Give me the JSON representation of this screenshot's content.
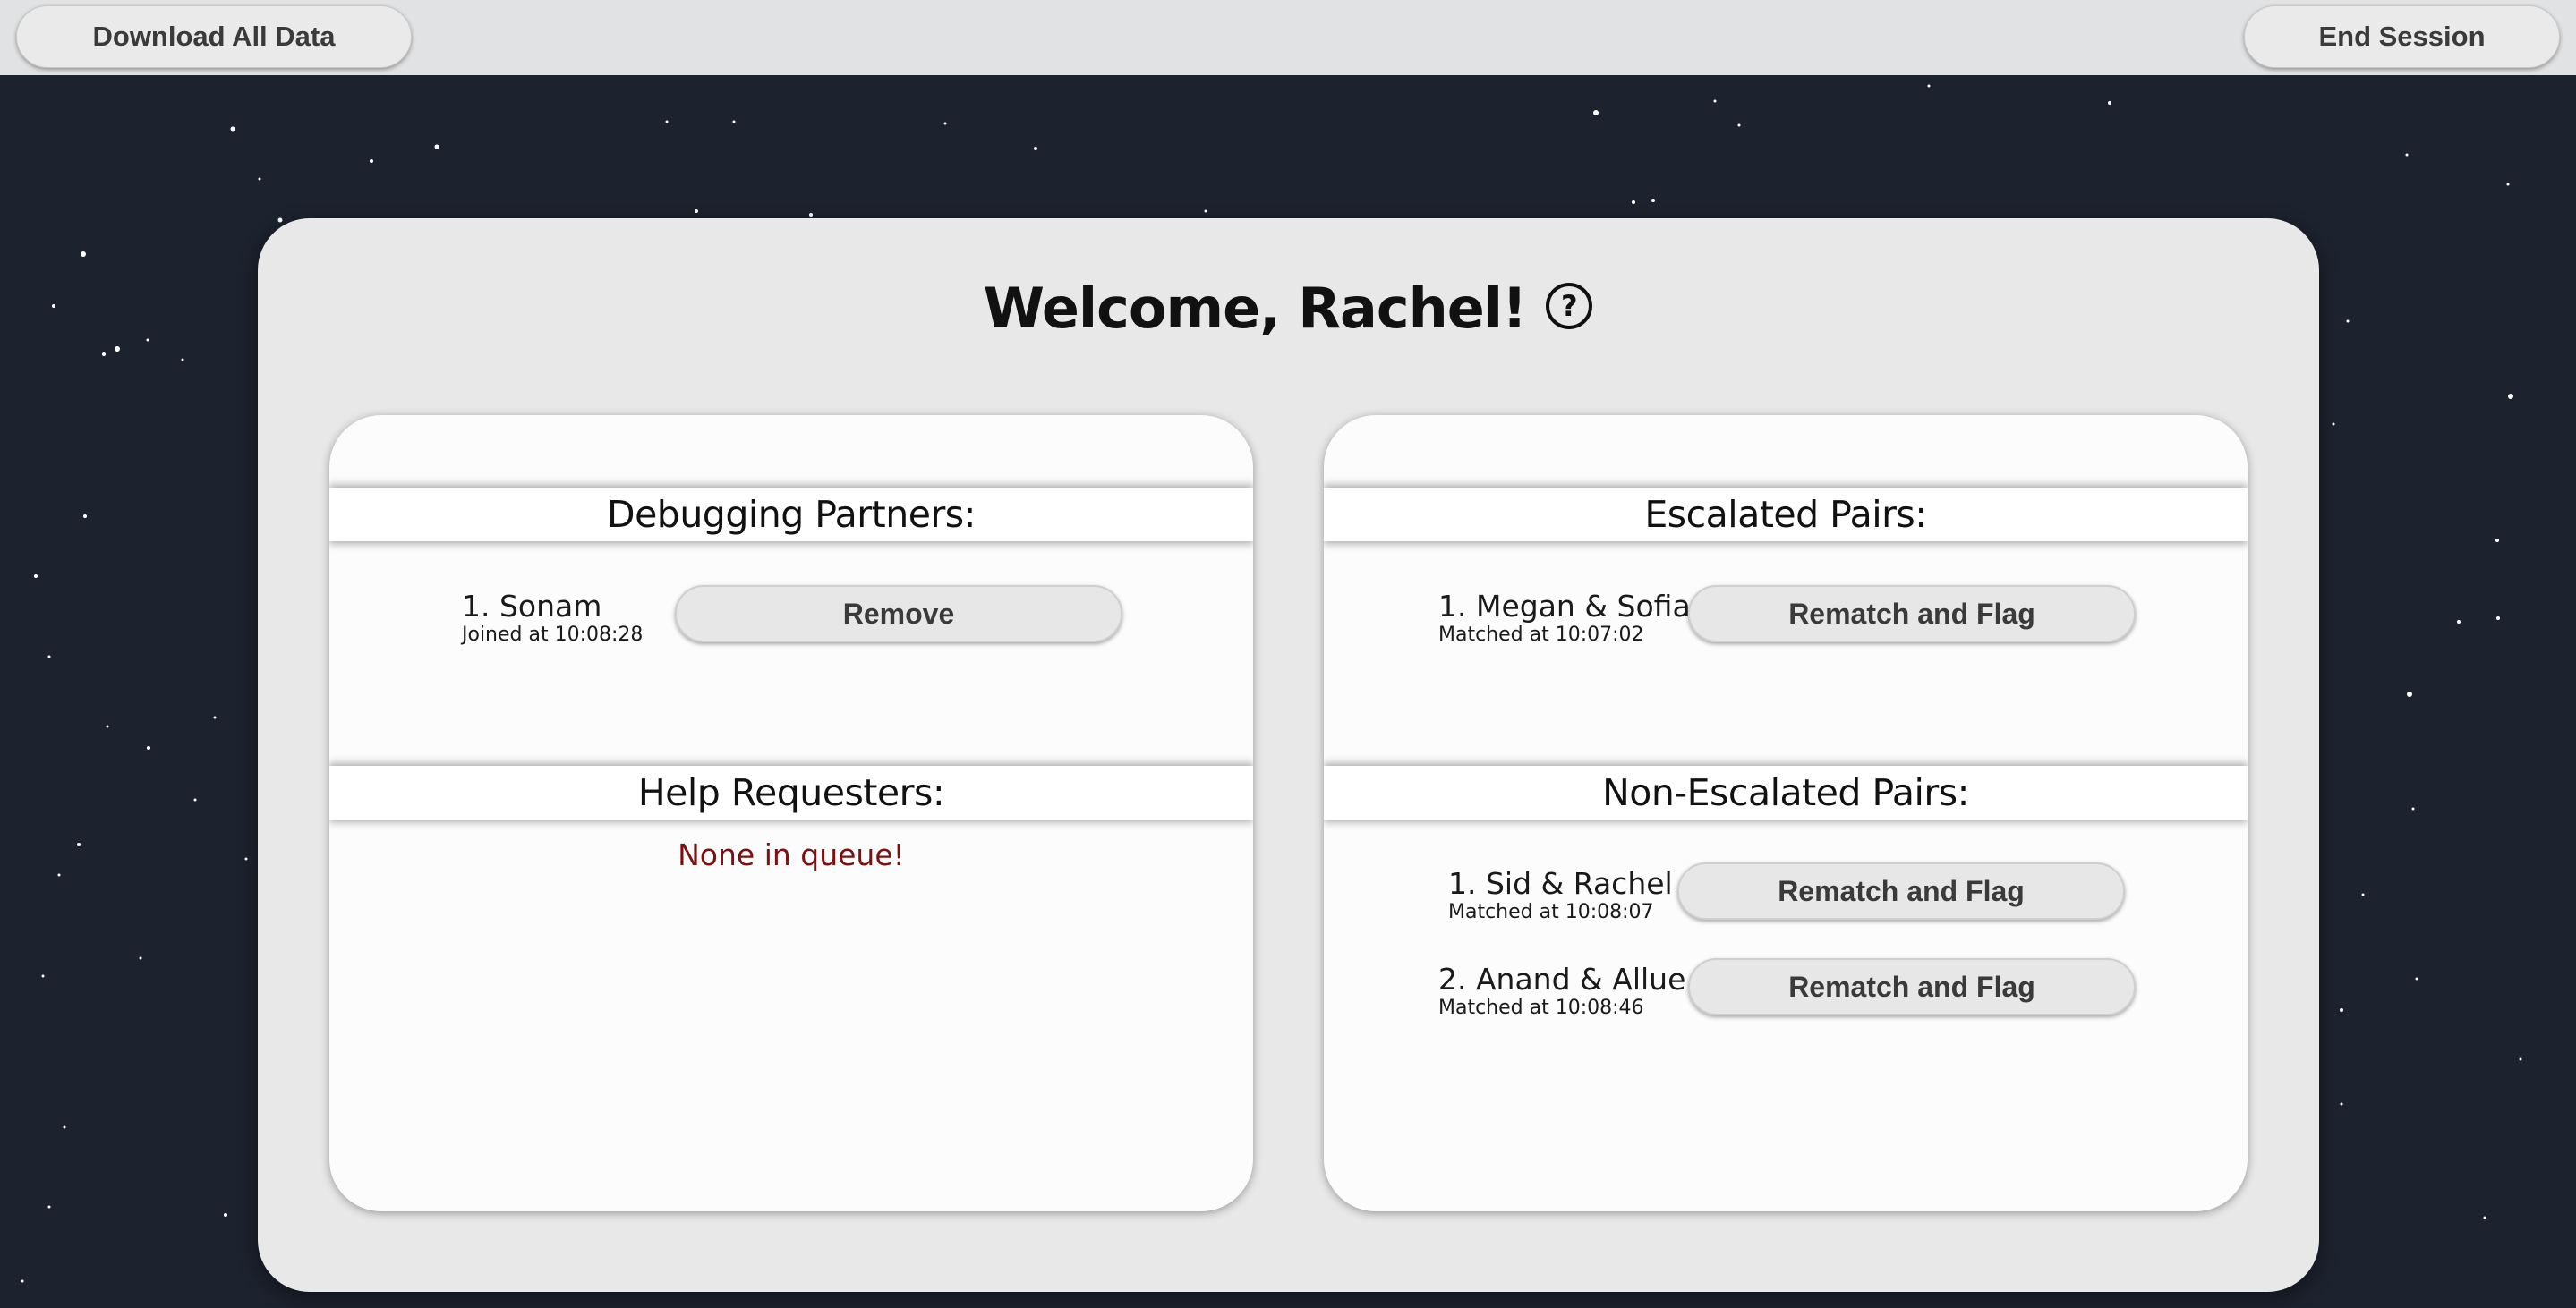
{
  "topbar": {
    "download_label": "Download All Data",
    "end_label": "End Session"
  },
  "welcome": {
    "title": "Welcome, Rachel!",
    "help_glyph": "?"
  },
  "debugging_partners": {
    "header": "Debugging Partners:",
    "items": [
      {
        "name": "1. Sonam",
        "time": "Joined at 10:08:28",
        "button": "Remove"
      }
    ]
  },
  "help_requesters": {
    "header": "Help Requesters:",
    "empty_message": "None in queue!"
  },
  "escalated_pairs": {
    "header": "Escalated Pairs:",
    "items": [
      {
        "name": "1. Megan & Sofia",
        "time": "Matched at 10:07:02",
        "button": "Rematch and Flag"
      }
    ]
  },
  "non_escalated_pairs": {
    "header": "Non-Escalated Pairs:",
    "items": [
      {
        "name": "1. Sid & Rachel",
        "time": "Matched at 10:08:07",
        "button": "Rematch and Flag"
      },
      {
        "name": "2. Anand & Allue",
        "time": "Matched at 10:08:46",
        "button": "Rematch and Flag"
      }
    ]
  },
  "colors": {
    "background": "#1c222e",
    "topbar": "#e1e2e3",
    "card": "#e8e8e9",
    "empty_message": "#7a1010"
  }
}
